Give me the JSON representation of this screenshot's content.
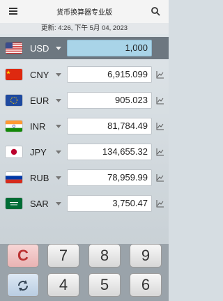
{
  "app": {
    "title": "货币换算器专业版",
    "updated": "更新: 4:26, 下午 5月 04, 2023"
  },
  "base": {
    "code": "USD",
    "value": "1,000"
  },
  "rows": [
    {
      "code": "CNY",
      "value": "6,915.099"
    },
    {
      "code": "EUR",
      "value": "905.023"
    },
    {
      "code": "INR",
      "value": "81,784.49"
    },
    {
      "code": "JPY",
      "value": "134,655.32"
    },
    {
      "code": "RUB",
      "value": "78,959.99"
    },
    {
      "code": "SAR",
      "value": "3,750.47"
    }
  ],
  "keypad": {
    "clear": "C",
    "k7": "7",
    "k8": "8",
    "k9": "9",
    "k4": "4",
    "k5": "5",
    "k6": "6"
  }
}
